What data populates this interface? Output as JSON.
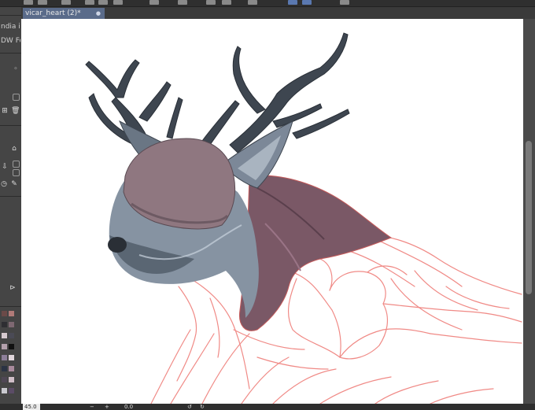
{
  "document_tab": {
    "title": "vicar_heart (2)*",
    "close_glyph": "●"
  },
  "left_panel": {
    "text_lines": [
      "ndia in",
      "DW Fo"
    ]
  },
  "status": {
    "zoom": "45.0",
    "minus": "−",
    "plus": "+",
    "rotation": "0.0"
  },
  "swatches": [
    "#6b4a48",
    "#b07a78",
    "#2e2e32",
    "#7e6872",
    "#d6c9cf",
    "#4a4a55",
    "#b4a1ad",
    "#111111",
    "#8d7f99",
    "#e1d6dc",
    "#2b3344",
    "#a98a9c",
    "#4f4755",
    "#d0bfc8",
    "#c9c9cf",
    "#5b4c66"
  ],
  "colors": {
    "sketch_line": "#f08a86",
    "fur_dark": "#4a5560",
    "fur_light": "#a9b4c0",
    "mask": "#8f7780",
    "cape": "#7a5866",
    "antler": "#3e4650"
  }
}
